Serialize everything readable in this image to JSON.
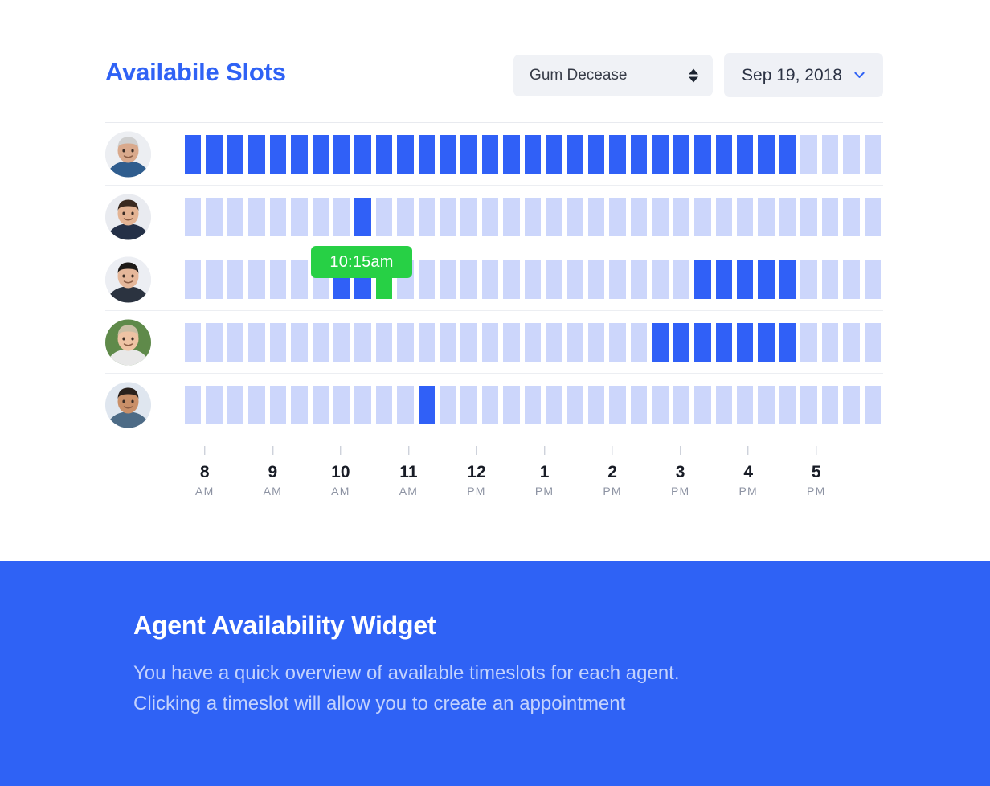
{
  "widget": {
    "title": "Availabile Slots",
    "service_select": {
      "value": "Gum Decease",
      "icon": "stepper-updown-icon"
    },
    "date_picker": {
      "value": "Sep 19, 2018",
      "icon": "chevron-down-icon"
    }
  },
  "tooltip": {
    "label": "10:15am",
    "color": "#27d045"
  },
  "colors": {
    "accent_blue": "#2f62f5",
    "slot_booked": "#3060f7",
    "slot_free": "#ccd6fb",
    "slot_selected": "#27d045",
    "banner_bg": "#2f62f5",
    "banner_sub_text": "#c3d2fd"
  },
  "axis": {
    "ticks": [
      {
        "hour": "8",
        "period": "AM"
      },
      {
        "hour": "9",
        "period": "AM"
      },
      {
        "hour": "10",
        "period": "AM"
      },
      {
        "hour": "11",
        "period": "AM"
      },
      {
        "hour": "12",
        "period": "PM"
      },
      {
        "hour": "1",
        "period": "PM"
      },
      {
        "hour": "2",
        "period": "PM"
      },
      {
        "hour": "3",
        "period": "PM"
      },
      {
        "hour": "4",
        "period": "PM"
      },
      {
        "hour": "5",
        "period": "PM"
      }
    ]
  },
  "slots_per_row": 33,
  "rows": [
    {
      "agent": "agent-1",
      "avatar": "older-man-photo",
      "states": [
        "booked",
        "booked",
        "booked",
        "booked",
        "booked",
        "booked",
        "booked",
        "booked",
        "booked",
        "booked",
        "booked",
        "booked",
        "booked",
        "booked",
        "booked",
        "booked",
        "booked",
        "booked",
        "booked",
        "booked",
        "booked",
        "booked",
        "booked",
        "booked",
        "booked",
        "booked",
        "booked",
        "booked",
        "booked",
        "free",
        "free",
        "free",
        "free"
      ]
    },
    {
      "agent": "agent-2",
      "avatar": "young-man-suit-photo",
      "states": [
        "free",
        "free",
        "free",
        "free",
        "free",
        "free",
        "free",
        "free",
        "booked",
        "free",
        "free",
        "free",
        "free",
        "free",
        "free",
        "free",
        "free",
        "free",
        "free",
        "free",
        "free",
        "free",
        "free",
        "free",
        "free",
        "free",
        "free",
        "free",
        "free",
        "free",
        "free",
        "free",
        "free"
      ]
    },
    {
      "agent": "agent-3",
      "avatar": "dark-hair-person-photo",
      "states": [
        "free",
        "free",
        "free",
        "free",
        "free",
        "free",
        "free",
        "booked",
        "booked",
        "selected",
        "free",
        "free",
        "free",
        "free",
        "free",
        "free",
        "free",
        "free",
        "free",
        "free",
        "free",
        "free",
        "free",
        "free",
        "booked",
        "booked",
        "booked",
        "booked",
        "booked",
        "free",
        "free",
        "free",
        "free"
      ]
    },
    {
      "agent": "agent-4",
      "avatar": "blonde-woman-photo",
      "states": [
        "free",
        "free",
        "free",
        "free",
        "free",
        "free",
        "free",
        "free",
        "free",
        "free",
        "free",
        "free",
        "free",
        "free",
        "free",
        "free",
        "free",
        "free",
        "free",
        "free",
        "free",
        "free",
        "booked",
        "booked",
        "booked",
        "booked",
        "booked",
        "booked",
        "booked",
        "free",
        "free",
        "free",
        "free"
      ]
    },
    {
      "agent": "agent-5",
      "avatar": "short-hair-person-photo",
      "states": [
        "free",
        "free",
        "free",
        "free",
        "free",
        "free",
        "free",
        "free",
        "free",
        "free",
        "free",
        "booked",
        "free",
        "free",
        "free",
        "free",
        "free",
        "free",
        "free",
        "free",
        "free",
        "free",
        "free",
        "free",
        "free",
        "free",
        "free",
        "free",
        "free",
        "free",
        "free",
        "free",
        "free"
      ]
    }
  ],
  "banner": {
    "title": "Agent Availability Widget",
    "line1": "You have a quick overview of available timeslots for each agent.",
    "line2": "Clicking a timeslot will allow you to create an appointment"
  }
}
